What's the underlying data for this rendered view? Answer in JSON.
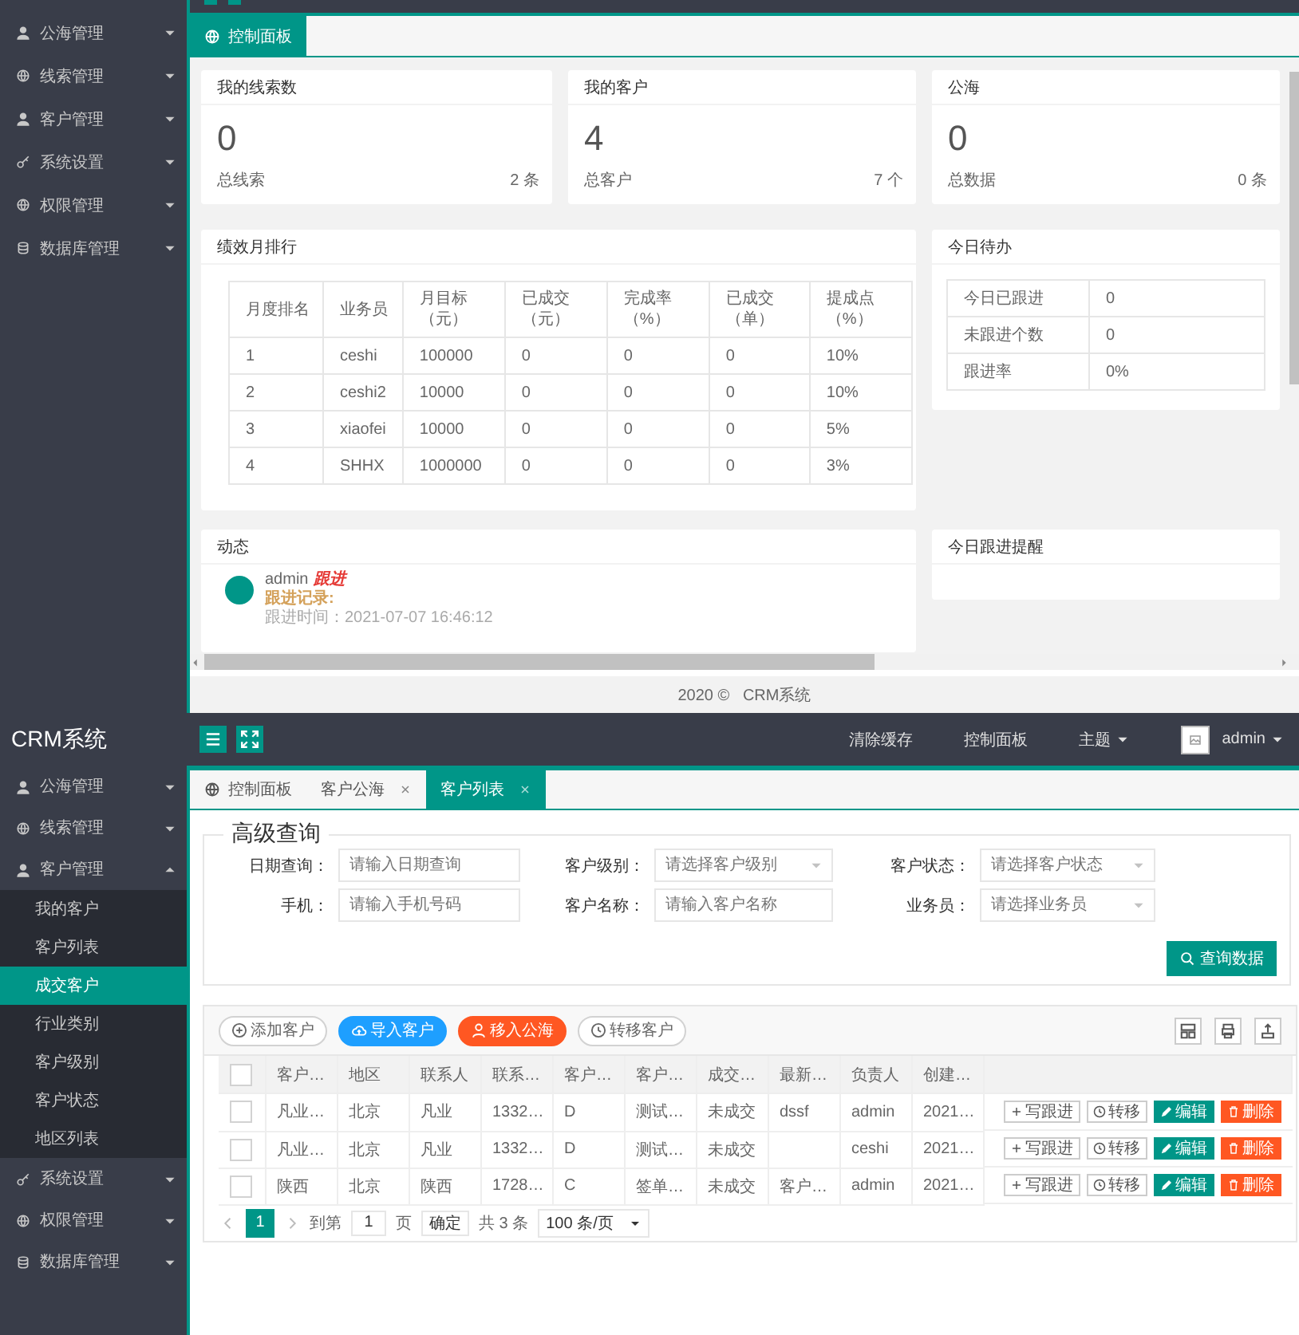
{
  "top": {
    "sidebar": [
      {
        "label": "公海管理",
        "expanded": false
      },
      {
        "label": "线索管理",
        "expanded": false
      },
      {
        "label": "客户管理",
        "expanded": false
      },
      {
        "label": "系统设置",
        "expanded": false
      },
      {
        "label": "权限管理",
        "expanded": false
      },
      {
        "label": "数据库管理",
        "expanded": false
      }
    ],
    "tabs": [
      {
        "label": "控制面板",
        "selected": true
      }
    ],
    "stat_cards": [
      {
        "title": "我的线索数",
        "value": "0",
        "caption": "总线索",
        "count": "2 条"
      },
      {
        "title": "我的客户",
        "value": "4",
        "caption": "总客户",
        "count": "7 个"
      },
      {
        "title": "公海",
        "value": "0",
        "caption": "总数据",
        "count": "0 条"
      }
    ],
    "ranking": {
      "title": "绩效月排行",
      "columns": [
        "月度排名",
        "业务员",
        "月目标（元）",
        "已成交（元）",
        "完成率（%）",
        "已成交（单）",
        "提成点（%）"
      ],
      "rows": [
        [
          "1",
          "ceshi",
          "100000",
          "0",
          "0",
          "0",
          "10%"
        ],
        [
          "2",
          "ceshi2",
          "10000",
          "0",
          "0",
          "0",
          "10%"
        ],
        [
          "3",
          "xiaofei",
          "10000",
          "0",
          "0",
          "0",
          "5%"
        ],
        [
          "4",
          "SHHX",
          "1000000",
          "0",
          "0",
          "0",
          "3%"
        ]
      ]
    },
    "todo": {
      "title": "今日待办",
      "rows": [
        [
          "今日已跟进",
          "0"
        ],
        [
          "未跟进个数",
          "0"
        ],
        [
          "跟进率",
          "0%"
        ]
      ]
    },
    "activity": {
      "title": "动态",
      "entries": [
        {
          "user": "admin",
          "action": "跟进",
          "record": "跟进记录:",
          "time": "跟进时间：2021-07-07 16:46:12"
        }
      ]
    },
    "reminder": {
      "title": "今日跟进提醒"
    },
    "footer": "2020 ©   CRM系统"
  },
  "bottom": {
    "logo": "CRM系统",
    "nav": [
      {
        "label": "清除缓存",
        "kind": "link"
      },
      {
        "label": "控制面板",
        "kind": "link"
      },
      {
        "label": "主题",
        "kind": "dropdown"
      }
    ],
    "user": "admin",
    "sidebar": [
      {
        "label": "公海管理",
        "expanded": false
      },
      {
        "label": "线索管理",
        "expanded": false
      },
      {
        "label": "客户管理",
        "expanded": true,
        "children": [
          {
            "label": "我的客户",
            "selected": false
          },
          {
            "label": "客户列表",
            "selected": false
          },
          {
            "label": "成交客户",
            "selected": true
          },
          {
            "label": "行业类别",
            "selected": false
          },
          {
            "label": "客户级别",
            "selected": false
          },
          {
            "label": "客户状态",
            "selected": false
          },
          {
            "label": "地区列表",
            "selected": false
          }
        ]
      },
      {
        "label": "系统设置",
        "expanded": false
      },
      {
        "label": "权限管理",
        "expanded": false
      },
      {
        "label": "数据库管理",
        "expanded": false
      }
    ],
    "tabs": [
      {
        "label": "控制面板",
        "selected": false,
        "closable": false
      },
      {
        "label": "客户公海",
        "selected": false,
        "closable": true
      },
      {
        "label": "客户列表",
        "selected": true,
        "closable": true
      }
    ],
    "search": {
      "title": "高级查询",
      "fields": [
        {
          "label": "日期查询：",
          "placeholder": "请输入日期查询",
          "kind": "input"
        },
        {
          "label": "客户级别：",
          "placeholder": "请选择客户级别",
          "kind": "select"
        },
        {
          "label": "客户状态：",
          "placeholder": "请选择客户状态",
          "kind": "select"
        },
        {
          "label": "手机：",
          "placeholder": "请输入手机号码",
          "kind": "input"
        },
        {
          "label": "客户名称：",
          "placeholder": "请输入客户名称",
          "kind": "input"
        },
        {
          "label": "业务员：",
          "placeholder": "请选择业务员",
          "kind": "select"
        }
      ],
      "button": "查询数据"
    },
    "toolbar": [
      {
        "label": "添加客户",
        "kind": "outline"
      },
      {
        "label": "导入客户",
        "kind": "primary"
      },
      {
        "label": "移入公海",
        "kind": "danger"
      },
      {
        "label": "转移客户",
        "kind": "outline"
      }
    ],
    "table": {
      "all_checked": false,
      "columns": [
        "客户…",
        "地区",
        "联系人",
        "联系…",
        "客户…",
        "客户…",
        "成交…",
        "最新…",
        "负责人",
        "创建…"
      ],
      "rows": [
        {
          "checked": false,
          "cells": [
            "凡业…",
            "北京",
            "凡业",
            "1332…",
            "D",
            "测试…",
            "未成交",
            "dssf",
            "admin",
            "2021…"
          ],
          "actions": [
            {
              "label": "写跟进",
              "kind": "outline"
            },
            {
              "label": "转移",
              "kind": "outline"
            },
            {
              "label": "编辑",
              "kind": "edit"
            },
            {
              "label": "删除",
              "kind": "delete"
            }
          ]
        },
        {
          "checked": false,
          "cells": [
            "凡业…",
            "北京",
            "凡业",
            "1332…",
            "D",
            "测试…",
            "未成交",
            null,
            "ceshi",
            "2021…"
          ],
          "actions": [
            {
              "label": "写跟进",
              "kind": "outline"
            },
            {
              "label": "转移",
              "kind": "outline"
            },
            {
              "label": "编辑",
              "kind": "edit"
            },
            {
              "label": "删除",
              "kind": "delete"
            }
          ]
        },
        {
          "checked": false,
          "cells": [
            "陕西",
            "北京",
            "陕西",
            "1728…",
            "C",
            "签单…",
            "未成交",
            "客户…",
            "admin",
            "2021…"
          ],
          "actions": [
            {
              "label": "写跟进",
              "kind": "outline"
            },
            {
              "label": "转移",
              "kind": "outline"
            },
            {
              "label": "编辑",
              "kind": "edit"
            },
            {
              "label": "删除",
              "kind": "delete"
            }
          ]
        }
      ]
    },
    "pagination": {
      "pages": [
        {
          "label": "1",
          "selected": true
        }
      ],
      "goto_label": "到第",
      "page_input": "1",
      "page_unit": "页",
      "confirm": "确定",
      "total": "共 3 条",
      "page_size": "100 条/页"
    }
  }
}
